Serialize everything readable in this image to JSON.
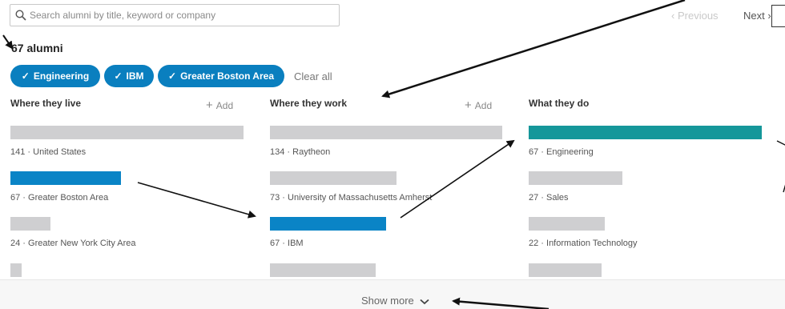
{
  "search": {
    "placeholder": "Search alumni by title, keyword or company"
  },
  "pagination": {
    "previous": "Previous",
    "next": "Next"
  },
  "summary": {
    "count_label": "67 alumni"
  },
  "filters": {
    "pills": [
      "Engineering",
      "IBM",
      "Greater Boston Area"
    ],
    "clear_all": "Clear all"
  },
  "columns": [
    {
      "title": "Where they live",
      "add_label": "Add",
      "items": [
        {
          "label": "141 · United States",
          "count": 141,
          "selected": false
        },
        {
          "label": "67 · Greater Boston Area",
          "count": 67,
          "selected": true
        },
        {
          "label": "24 · Greater New York City Area",
          "count": 24,
          "selected": false
        },
        {
          "label": "",
          "count": 6,
          "selected": false
        }
      ]
    },
    {
      "title": "Where they work",
      "add_label": "Add",
      "items": [
        {
          "label": "134 · Raytheon",
          "count": 134,
          "selected": false
        },
        {
          "label": "73 · University of Massachusetts Amherst",
          "count": 73,
          "selected": false
        },
        {
          "label": "67 · IBM",
          "count": 67,
          "selected": true
        },
        {
          "label": "",
          "count": 60,
          "selected": false
        }
      ]
    },
    {
      "title": "What they do",
      "items": [
        {
          "label": "67 · Engineering",
          "count": 67,
          "selected": true
        },
        {
          "label": "27 · Sales",
          "count": 27,
          "selected": false
        },
        {
          "label": "22 · Information Technology",
          "count": 22,
          "selected": false
        },
        {
          "label": "",
          "count": 21,
          "selected": false
        }
      ]
    }
  ],
  "show_more": "Show more",
  "colors": {
    "selected_blue": "#0a84c6",
    "selected_teal": "#15979a",
    "unselected": "#cfcfd1"
  }
}
